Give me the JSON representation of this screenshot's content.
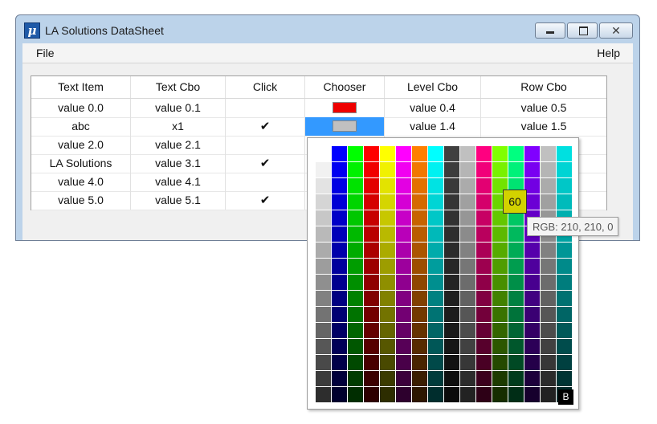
{
  "window": {
    "title": "LA Solutions DataSheet",
    "app_icon_glyph": "μ",
    "buttons": {
      "minimize": "minimize-icon",
      "maximize": "maximize-icon",
      "close": "close-icon"
    }
  },
  "menu": {
    "file": "File",
    "help": "Help"
  },
  "table": {
    "headers": [
      "Text Item",
      "Text Cbo",
      "Click",
      "Chooser",
      "Level Cbo",
      "Row Cbo"
    ],
    "rows": [
      {
        "text_item": "value 0.0",
        "text_cbo": "value 0.1",
        "click": "",
        "chooser_color": "#ee0000",
        "level_cbo": "value 0.4",
        "row_cbo": "value 0.5"
      },
      {
        "text_item": "abc",
        "text_cbo": "x1",
        "click": "✔",
        "chooser_color": "#c0c0c0",
        "level_cbo": "value 1.4",
        "row_cbo": "value 1.5"
      },
      {
        "text_item": "value 2.0",
        "text_cbo": "value 2.1",
        "click": "",
        "level_cbo": "",
        "row_cbo": ""
      },
      {
        "text_item": "LA Solutions",
        "text_cbo": "value 3.1",
        "click": "✔",
        "level_cbo": "",
        "row_cbo": ""
      },
      {
        "text_item": "value 4.0",
        "text_cbo": "value 4.1",
        "click": "",
        "level_cbo": "",
        "row_cbo": ""
      },
      {
        "text_item": "value 5.0",
        "text_cbo": "value 5.1",
        "click": "✔",
        "level_cbo": "",
        "row_cbo": ""
      }
    ]
  },
  "palette": {
    "highlight_label": "60",
    "highlight_color": "#d2d200",
    "tooltip": "RGB: 210, 210, 0",
    "corner_label": "B",
    "columns": [
      "#ffffff",
      "#0000ff",
      "#00ff00",
      "#ff0000",
      "#ffff00",
      "#ff00ff",
      "#ff7f00",
      "#00ffff",
      "#404040",
      "#c0c0c0",
      "#ff0080",
      "#80ff00",
      "#00ff80",
      "#8000ff",
      "#c0c0c0",
      "#00e0e0"
    ]
  }
}
